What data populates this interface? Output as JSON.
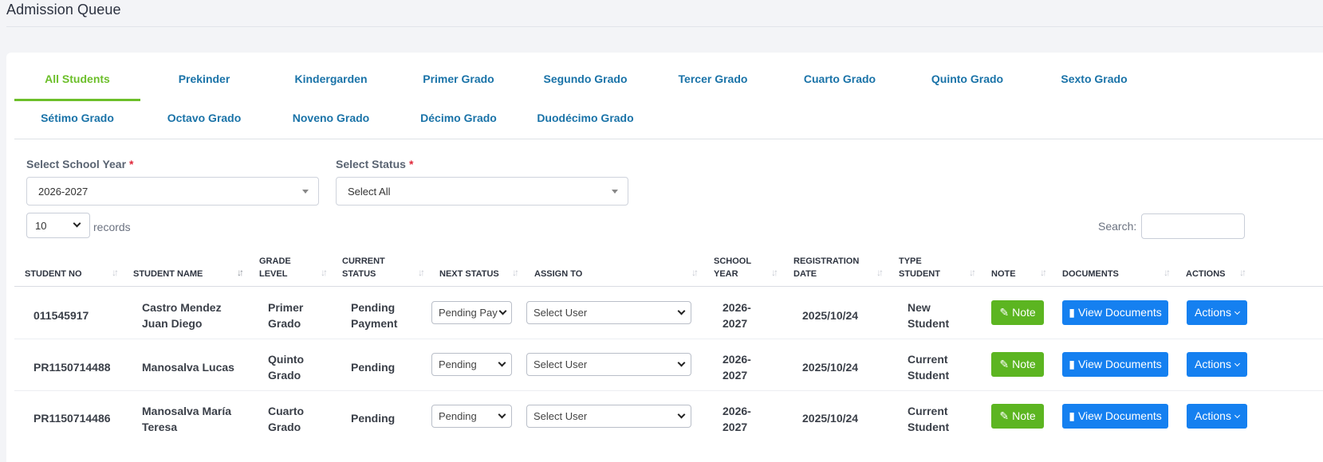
{
  "page": {
    "title": "Admission Queue"
  },
  "tabs": [
    "All Students",
    "Prekinder",
    "Kindergarden",
    "Primer Grado",
    "Segundo Grado",
    "Tercer Grado",
    "Cuarto Grado",
    "Quinto Grado",
    "Sexto Grado",
    "Sétimo Grado",
    "Octavo Grado",
    "Noveno Grado",
    "Décimo Grado",
    "Duodécimo Grado"
  ],
  "active_tab": "All Students",
  "filters": {
    "school_year": {
      "label": "Select School Year",
      "required_mark": "*",
      "value": "2026-2027"
    },
    "status": {
      "label": "Select Status",
      "required_mark": "*",
      "value": "Select All"
    }
  },
  "length": {
    "value": "10",
    "suffix": "records"
  },
  "search": {
    "label": "Search:",
    "value": ""
  },
  "table": {
    "columns": [
      "STUDENT NO",
      "STUDENT NAME",
      "GRADE LEVEL",
      "CURRENT STATUS",
      "NEXT STATUS",
      "ASSIGN TO",
      "SCHOOL YEAR",
      "REGISTRATION DATE",
      "TYPE STUDENT",
      "NOTE",
      "DOCUMENTS",
      "ACTIONS"
    ],
    "columns_wrapped": {
      "grade": [
        "GRADE",
        "LEVEL"
      ],
      "current": [
        "CURRENT",
        "STATUS"
      ],
      "school": [
        "SCHOOL",
        "YEAR"
      ],
      "reg": [
        "REGISTRATION",
        "DATE"
      ],
      "type": [
        "TYPE",
        "STUDENT"
      ]
    },
    "rows": [
      {
        "student_no": "011545917",
        "name": [
          "Castro Mendez",
          "Juan Diego"
        ],
        "grade": [
          "Primer",
          "Grado"
        ],
        "current_status": [
          "Pending",
          "Payment"
        ],
        "next_status": "Pending Pay",
        "assign_to": "Select User",
        "school_year": [
          "2026-",
          "2027"
        ],
        "registration_date": "2025/10/24",
        "type_student": [
          "New",
          "Student"
        ],
        "note_label": "Note",
        "documents_label": "View Documents",
        "actions_label": "Actions"
      },
      {
        "student_no": "PR1150714488",
        "name": [
          "Manosalva Lucas"
        ],
        "grade": [
          "Quinto",
          "Grado"
        ],
        "current_status": [
          "Pending"
        ],
        "next_status": "Pending",
        "assign_to": "Select User",
        "school_year": [
          "2026-",
          "2027"
        ],
        "registration_date": "2025/10/24",
        "type_student": [
          "Current",
          "Student"
        ],
        "note_label": "Note",
        "documents_label": "View Documents",
        "actions_label": "Actions"
      },
      {
        "student_no": "PR1150714486",
        "name": [
          "Manosalva María",
          "Teresa"
        ],
        "grade": [
          "Cuarto",
          "Grado"
        ],
        "current_status": [
          "Pending"
        ],
        "next_status": "Pending",
        "assign_to": "Select User",
        "school_year": [
          "2026-",
          "2027"
        ],
        "registration_date": "2025/10/24",
        "type_student": [
          "Current",
          "Student"
        ],
        "note_label": "Note",
        "documents_label": "View Documents",
        "actions_label": "Actions"
      }
    ]
  },
  "colors": {
    "accent_green": "#6cbf2a",
    "tab_blue": "#1a73a8",
    "button_blue": "#1580f0",
    "button_green": "#5cb521"
  }
}
